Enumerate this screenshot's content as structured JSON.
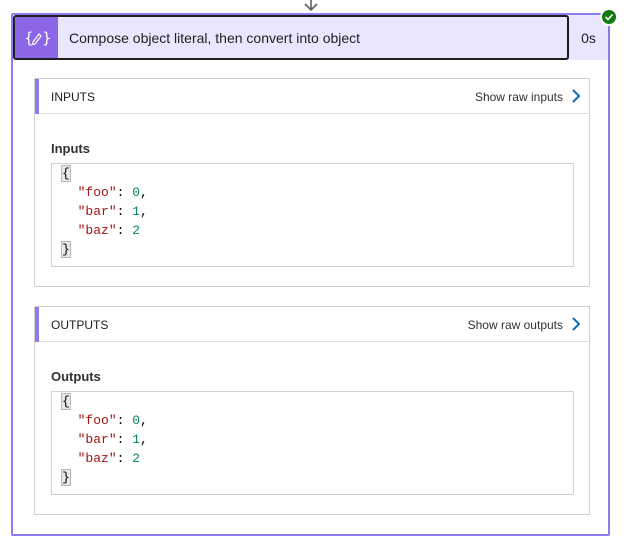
{
  "action": {
    "title": "Compose object literal, then convert into object",
    "duration": "0s",
    "icon": "compose-icon",
    "status_icon": "checkmark-icon",
    "accent_color": "#8b66e6",
    "header_bg": "#e9e6ff",
    "success_color": "#107c10"
  },
  "inputs": {
    "section_title": "INPUTS",
    "raw_link": "Show raw inputs",
    "label": "Inputs",
    "json": {
      "open": "{",
      "close": "}",
      "entries": [
        {
          "key": "\"foo\"",
          "value": "0",
          "sep": ","
        },
        {
          "key": "\"bar\"",
          "value": "1",
          "sep": ","
        },
        {
          "key": "\"baz\"",
          "value": "2",
          "sep": ""
        }
      ]
    }
  },
  "outputs": {
    "section_title": "OUTPUTS",
    "raw_link": "Show raw outputs",
    "label": "Outputs",
    "json": {
      "open": "{",
      "close": "}",
      "entries": [
        {
          "key": "\"foo\"",
          "value": "0",
          "sep": ","
        },
        {
          "key": "\"bar\"",
          "value": "1",
          "sep": ","
        },
        {
          "key": "\"baz\"",
          "value": "2",
          "sep": ""
        }
      ]
    }
  }
}
